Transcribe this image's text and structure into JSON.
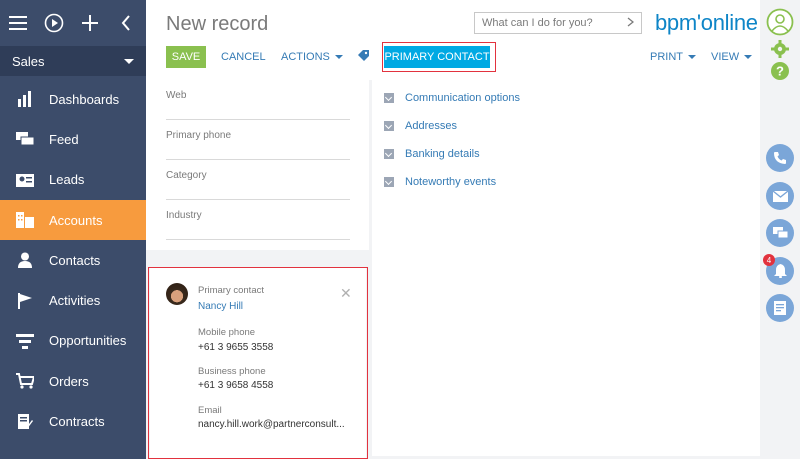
{
  "sidebar": {
    "workspace": "Sales",
    "items": [
      {
        "label": "Dashboards",
        "icon": "dashboards-icon"
      },
      {
        "label": "Feed",
        "icon": "feed-icon"
      },
      {
        "label": "Leads",
        "icon": "leads-icon"
      },
      {
        "label": "Accounts",
        "icon": "accounts-icon",
        "active": true
      },
      {
        "label": "Contacts",
        "icon": "contacts-icon"
      },
      {
        "label": "Activities",
        "icon": "activities-icon"
      },
      {
        "label": "Opportunities",
        "icon": "opportunities-icon"
      },
      {
        "label": "Orders",
        "icon": "orders-icon"
      },
      {
        "label": "Contracts",
        "icon": "contracts-icon"
      }
    ]
  },
  "header": {
    "title": "New record",
    "search_placeholder": "What can I do for you?",
    "logo": "bpm'online"
  },
  "toolbar": {
    "save_label": "SAVE",
    "cancel_label": "CANCEL",
    "actions_label": "ACTIONS",
    "primary_contact_label": "PRIMARY CONTACT",
    "print_label": "PRINT",
    "view_label": "VIEW"
  },
  "fields": {
    "web": "Web",
    "primary_phone": "Primary phone",
    "category": "Category",
    "industry": "Industry"
  },
  "contact_card": {
    "heading": "Primary contact",
    "name": "Nancy Hill",
    "mobile_label": "Mobile phone",
    "mobile_value": "+61 3 9655 3558",
    "business_label": "Business phone",
    "business_value": "+61 3 9658 4558",
    "email_label": "Email",
    "email_value": "nancy.hill.work@partnerconsult..."
  },
  "groups": [
    "Communication options",
    "Addresses",
    "Banking details",
    "Noteworthy events"
  ],
  "notifications": {
    "count": "4"
  },
  "colors": {
    "sidebar": "#3c4c6a",
    "active": "#f79b3e",
    "save": "#8ac04f",
    "primary": "#00a9e3",
    "highlight": "#e2323e",
    "link": "#357bb5"
  }
}
